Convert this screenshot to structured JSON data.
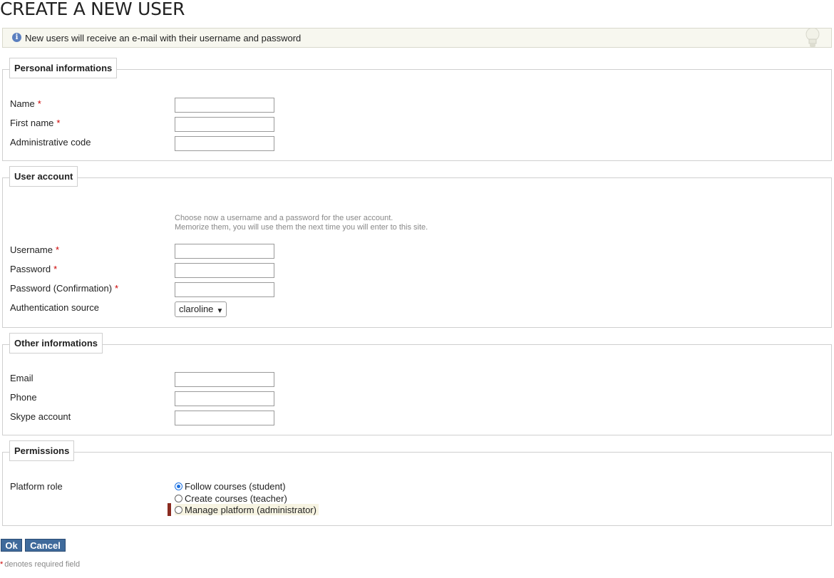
{
  "page": {
    "title": "CREATE A NEW USER",
    "info_message": "New users will receive an e-mail with their username and password"
  },
  "sections": {
    "personal": {
      "legend": "Personal informations",
      "name_label": "Name",
      "first_name_label": "First name",
      "admin_code_label": "Administrative code",
      "name_value": "",
      "first_name_value": "",
      "admin_code_value": ""
    },
    "account": {
      "legend": "User account",
      "help_line1": "Choose now a username and a password for the user account.",
      "help_line2": "Memorize them, you will use them the next time you will enter to this site.",
      "username_label": "Username",
      "password_label": "Password",
      "password_confirm_label": "Password (Confirmation)",
      "auth_source_label": "Authentication source",
      "auth_source_value": "claroline",
      "username_value": "",
      "password_value": "",
      "password_confirm_value": ""
    },
    "other": {
      "legend": "Other informations",
      "email_label": "Email",
      "phone_label": "Phone",
      "skype_label": "Skype account",
      "email_value": "",
      "phone_value": "",
      "skype_value": ""
    },
    "permissions": {
      "legend": "Permissions",
      "platform_role_label": "Platform role",
      "roles": [
        {
          "label": "Follow courses (student)",
          "checked": true
        },
        {
          "label": "Create courses (teacher)",
          "checked": false
        },
        {
          "label": "Manage platform (administrator)",
          "checked": false
        }
      ]
    }
  },
  "required_marker": "*",
  "buttons": {
    "ok": "Ok",
    "cancel": "Cancel"
  },
  "footnote": "denotes required field",
  "colors": {
    "required": "#cc0000",
    "button_bg": "#3f6a9b",
    "info_bg": "#f7f7ef"
  },
  "icons": {
    "info": "info-icon",
    "lightbulb": "lightbulb-icon",
    "select_caret": "chevron-down-icon"
  }
}
